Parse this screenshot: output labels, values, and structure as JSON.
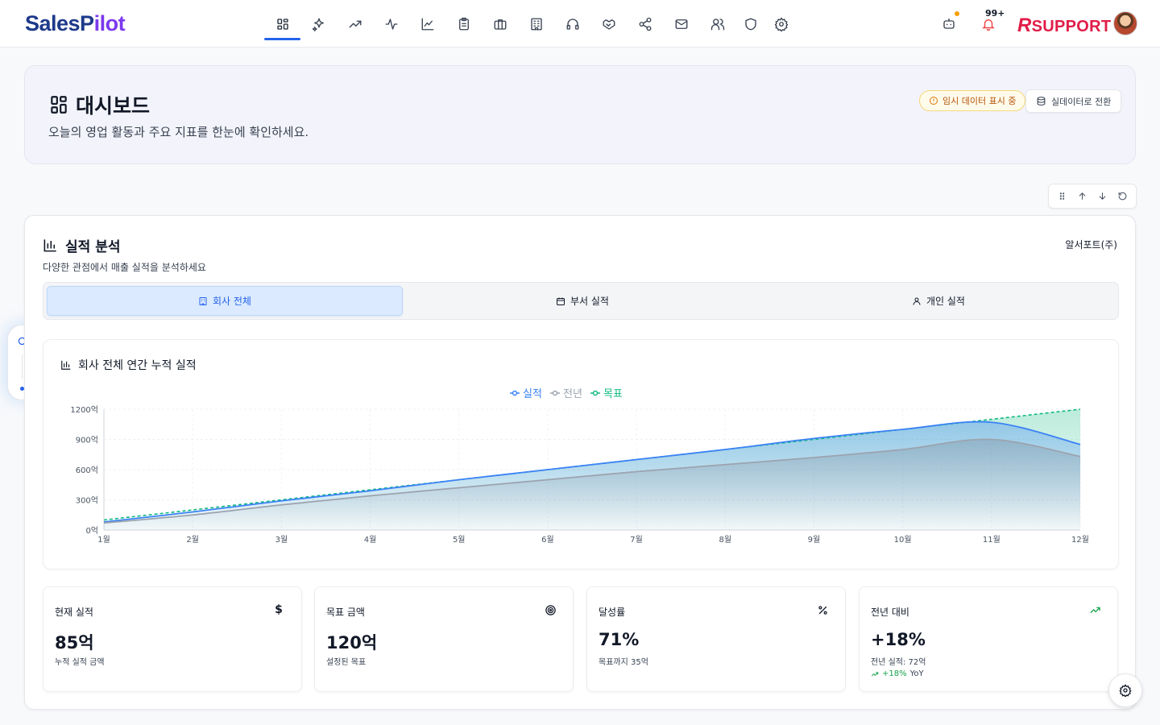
{
  "app": {
    "logo_part1": "SalesP",
    "logo_part2": "ilot"
  },
  "topbar": {
    "nav": [
      {
        "name": "dashboard-icon"
      },
      {
        "name": "sparkles-icon"
      },
      {
        "name": "trending-up-icon"
      },
      {
        "name": "activity-icon"
      },
      {
        "name": "line-chart-icon"
      },
      {
        "name": "clipboard-icon"
      },
      {
        "name": "briefcase-icon"
      },
      {
        "name": "building-icon"
      },
      {
        "name": "headphones-icon"
      },
      {
        "name": "handshake-icon"
      },
      {
        "name": "share-icon"
      },
      {
        "name": "mail-icon"
      },
      {
        "name": "users-icon"
      },
      {
        "name": "shield-icon"
      },
      {
        "name": "settings-icon"
      }
    ],
    "notif_count": "99+",
    "brand_r": "R",
    "brand_rest": "SUPPORT"
  },
  "header": {
    "title": "대시보드",
    "subtitle": "오늘의 영업 활동과 주요 지표를 한눈에 확인하세요.",
    "demo_badge": "임시 데이터 표시 중",
    "switch_button": "실데이터로 전환"
  },
  "section": {
    "title": "실적 분석",
    "subtitle": "다양한 관점에서 매출 실적을 분석하세요",
    "company": "알서포트(주)",
    "tabs": [
      {
        "label": "회사 전체",
        "active": true
      },
      {
        "label": "부서 실적",
        "active": false
      },
      {
        "label": "개인 실적",
        "active": false
      }
    ]
  },
  "chart_data": {
    "type": "area",
    "title": "회사 전체 연간 누적 실적",
    "categories": [
      "1월",
      "2월",
      "3월",
      "4월",
      "5월",
      "6월",
      "7월",
      "8월",
      "9월",
      "10월",
      "11월",
      "12월"
    ],
    "y_ticks": [
      "0억",
      "300억",
      "600억",
      "900억",
      "1200억"
    ],
    "ylim": [
      0,
      1200
    ],
    "legend_position": "top-center",
    "series": [
      {
        "name": "실적",
        "color": "#3b82f6",
        "values": [
          80,
          180,
          290,
          390,
          500,
          600,
          700,
          800,
          910,
          1000,
          1070,
          850
        ]
      },
      {
        "name": "전년",
        "color": "#9ca3af",
        "values": [
          70,
          150,
          250,
          340,
          420,
          500,
          580,
          650,
          720,
          800,
          900,
          730
        ]
      },
      {
        "name": "목표",
        "color": "#10b981",
        "values": [
          100,
          200,
          300,
          400,
          500,
          600,
          700,
          800,
          900,
          1000,
          1100,
          1200
        ]
      }
    ]
  },
  "kpis": [
    {
      "label": "현재 실적",
      "icon": "dollar-icon",
      "value": "85억",
      "sub": "누적 실적 금액"
    },
    {
      "label": "목표 금액",
      "icon": "target-icon",
      "value": "120억",
      "sub": "설정된 목표"
    },
    {
      "label": "달성률",
      "icon": "percent-icon",
      "value": "71%",
      "sub": "목표까지 35억"
    },
    {
      "label": "전년 대비",
      "icon": "trending-up-icon",
      "value": "+18%",
      "sub": "전년 실적: 72억",
      "yoy_value": "+18%",
      "yoy_label": "YoY"
    }
  ]
}
